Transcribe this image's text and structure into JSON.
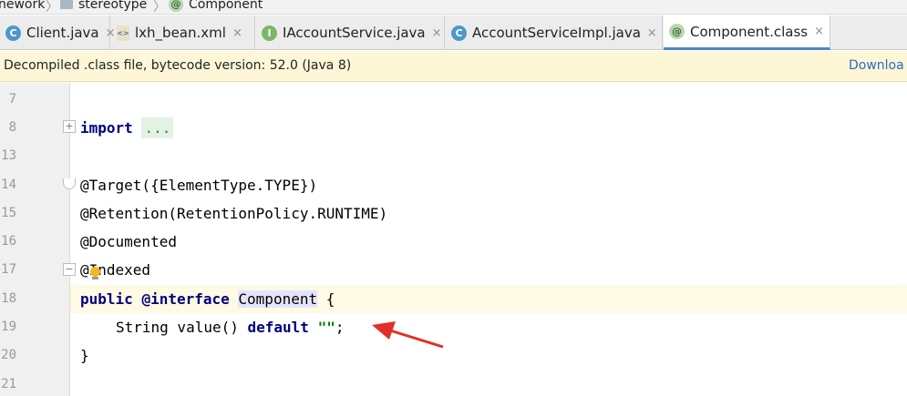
{
  "breadcrumb": {
    "items": [
      "nework",
      "stereotype",
      "Component"
    ]
  },
  "tabs": [
    {
      "label": "Client.java",
      "icon": "class-icon",
      "glyph": "C"
    },
    {
      "label": "lxh_bean.xml",
      "icon": "xml-file-icon",
      "glyph": "<>"
    },
    {
      "label": "IAccountService.java",
      "icon": "interface-icon",
      "glyph": "I"
    },
    {
      "label": "AccountServiceImpl.java",
      "icon": "class-icon",
      "glyph": "C"
    },
    {
      "label": "Component.class",
      "icon": "annotation-icon",
      "glyph": "@",
      "active": true
    }
  ],
  "tab_close": "×",
  "banner": {
    "text": "Decompiled .class file, bytecode version: 52.0 (Java 8)",
    "link": "Downloa"
  },
  "editor": {
    "line_numbers": [
      "7",
      "8",
      "13",
      "14",
      "15",
      "16",
      "17",
      "18",
      "19",
      "20",
      "21"
    ],
    "code": {
      "import_kw": "import",
      "import_fold": "...",
      "target": "@Target({ElementType.TYPE})",
      "retention": "@Retention(RetentionPolicy.RUNTIME)",
      "documented": "@Documented",
      "indexed": "@Indexed",
      "public_kw": "public",
      "interface_kw": "@interface",
      "class_name": "Component",
      "open_brace": "{",
      "method_sig": "String value()",
      "default_kw": "default",
      "default_value": "\"\"",
      "semicolon": ";",
      "close_brace": "}"
    }
  },
  "colors": {
    "keyword": "#000080",
    "string": "#008000",
    "banner_bg": "#fdf7d7",
    "active_line": "#fffae3",
    "arrow": "#e0302a"
  }
}
